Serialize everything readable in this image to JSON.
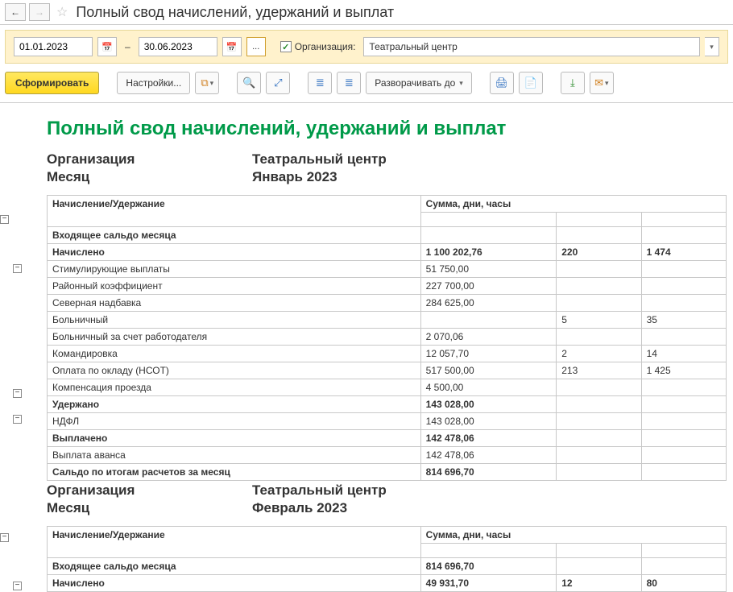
{
  "titlebar": {
    "title": "Полный свод начислений, удержаний и выплат"
  },
  "filter": {
    "date_from": "01.01.2023",
    "date_to": "30.06.2023",
    "dots": "...",
    "org_label": "Организация:",
    "org_value": "Театральный центр"
  },
  "toolbar": {
    "generate": "Сформировать",
    "settings": "Настройки...",
    "expand": "Разворачивать до"
  },
  "report": {
    "title": "Полный свод начислений, удержаний и выплат",
    "org_label": "Организация",
    "month_label": "Месяц",
    "headers": {
      "name": "Начисление/Удержание",
      "sum": "Сумма, дни, часы"
    },
    "sections": [
      {
        "org_value": "Театральный центр",
        "month_value": "Январь 2023",
        "rows": [
          {
            "type": "bold",
            "name": "Входящее сальдо месяца",
            "sum": "",
            "days": "",
            "hours": ""
          },
          {
            "type": "bold",
            "name": "Начислено",
            "sum": "1 100 202,76",
            "days": "220",
            "hours": "1 474"
          },
          {
            "type": "plain",
            "name": "Стимулирующие выплаты",
            "sum": "51 750,00",
            "days": "",
            "hours": ""
          },
          {
            "type": "plain",
            "name": "Районный коэффициент",
            "sum": "227 700,00",
            "days": "",
            "hours": ""
          },
          {
            "type": "plain",
            "name": "Северная надбавка",
            "sum": "284 625,00",
            "days": "",
            "hours": ""
          },
          {
            "type": "plain",
            "name": "Больничный",
            "sum": "",
            "days": "5",
            "hours": "35"
          },
          {
            "type": "plain",
            "name": "Больничный за счет работодателя",
            "sum": "2 070,06",
            "days": "",
            "hours": ""
          },
          {
            "type": "plain",
            "name": "Командировка",
            "sum": "12 057,70",
            "days": "2",
            "hours": "14"
          },
          {
            "type": "plain",
            "name": "Оплата по окладу (НСОТ)",
            "sum": "517 500,00",
            "days": "213",
            "hours": "1 425"
          },
          {
            "type": "plain",
            "name": "Компенсация проезда",
            "sum": "4 500,00",
            "days": "",
            "hours": ""
          },
          {
            "type": "bold",
            "name": "Удержано",
            "sum": "143 028,00",
            "days": "",
            "hours": ""
          },
          {
            "type": "plain",
            "name": "НДФЛ",
            "sum": "143 028,00",
            "days": "",
            "hours": ""
          },
          {
            "type": "bold",
            "name": "Выплачено",
            "sum": "142 478,06",
            "days": "",
            "hours": ""
          },
          {
            "type": "plain",
            "name": "Выплата аванса",
            "sum": "142 478,06",
            "days": "",
            "hours": ""
          },
          {
            "type": "bold",
            "name": "Сальдо по итогам расчетов за месяц",
            "sum": "814 696,70",
            "days": "",
            "hours": ""
          }
        ]
      },
      {
        "org_value": "Театральный центр",
        "month_value": "Февраль 2023",
        "rows": [
          {
            "type": "bold",
            "name": "Входящее сальдо месяца",
            "sum": "814 696,70",
            "days": "",
            "hours": ""
          },
          {
            "type": "bold",
            "name": "Начислено",
            "sum": "49 931,70",
            "days": "12",
            "hours": "80"
          }
        ]
      }
    ]
  }
}
